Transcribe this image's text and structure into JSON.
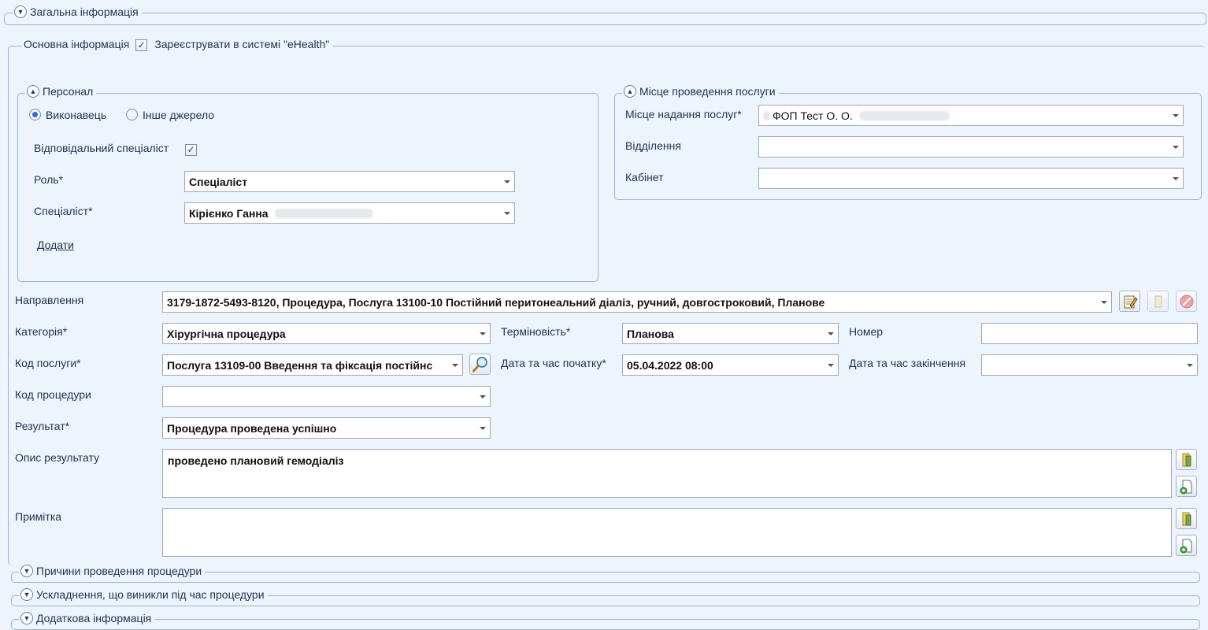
{
  "sections": {
    "general": "Загальна інформація",
    "reasons": "Причини проведення процедури",
    "complications": "Ускладнення, що виникли під час процедури",
    "additional": "Додаткова інформація"
  },
  "main_info": {
    "tab_label": "Основна інформація",
    "register_label": "Зареєструвати в системі \"eHealth\"",
    "register_checked": true
  },
  "personnel": {
    "title": "Персонал",
    "radio_executor": "Виконавець",
    "radio_other": "Інше джерело",
    "responsible_label": "Відповідальний спеціаліст",
    "responsible_checked": true,
    "role_label": "Роль*",
    "role_value": "Спеціаліст",
    "specialist_label": "Спеціаліст*",
    "specialist_value": "Кірієнко Ганна",
    "add_link": "Додати"
  },
  "location": {
    "title": "Місце проведення послуги",
    "place_label": "Місце надання послуг*",
    "place_value": "ФОП Тест О. О.",
    "department_label": "Відділення",
    "department_value": "",
    "cabinet_label": "Кабінет",
    "cabinet_value": ""
  },
  "form": {
    "referral_label": "Направлення",
    "referral_value": "3179-1872-5493-8120, Процедура, Послуга 13100-10 Постійний перитонеальний діаліз, ручний, довгостроковий, Планове",
    "category_label": "Категорія*",
    "category_value": "Хірургічна процедура",
    "urgency_label": "Терміновість*",
    "urgency_value": "Планова",
    "number_label": "Номер",
    "number_value": "",
    "service_code_label": "Код послуги*",
    "service_code_value": "Послуга 13109-00 Введення та фіксація постійнс",
    "start_label": "Дата та час початку*",
    "start_value": "05.04.2022 08:00",
    "end_label": "Дата та час закінчення",
    "end_value": "",
    "procedure_code_label": "Код процедури",
    "procedure_code_value": "",
    "result_label": "Результат*",
    "result_value": "Процедура проведена успішно",
    "result_desc_label": "Опис результату",
    "result_desc_value": "проведено плановий гемодіаліз",
    "note_label": "Примітка",
    "note_value": ""
  },
  "colors": {
    "background": "#eef4fc",
    "border": "#9cb3d0",
    "text": "#1e3152"
  }
}
